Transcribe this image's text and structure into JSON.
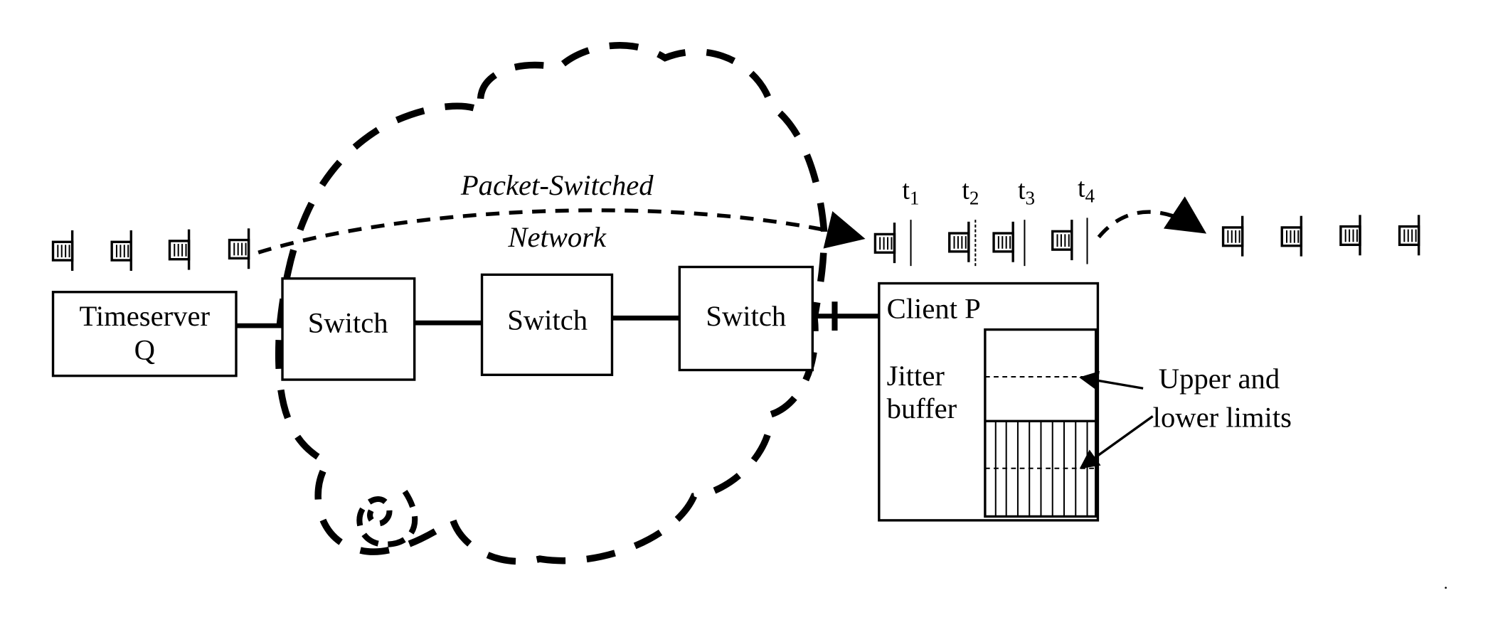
{
  "diagram": {
    "network_label_line1": "Packet-Switched",
    "network_label_line2": "Network",
    "timeserver_label_line1": "Timeserver",
    "timeserver_label_line2": "Q",
    "switches": [
      {
        "label": "Switch"
      },
      {
        "label": "Switch"
      },
      {
        "label": "Switch"
      }
    ],
    "client_label": "Client P",
    "jitter_label_line1": "Jitter",
    "jitter_label_line2": "buffer",
    "limits_label_line1": "Upper and",
    "limits_label_line2": "lower limits",
    "arrival_times": [
      {
        "base": "t",
        "sub": "1"
      },
      {
        "base": "t",
        "sub": "2"
      },
      {
        "base": "t",
        "sub": "3"
      },
      {
        "base": "t",
        "sub": "4"
      }
    ],
    "outgoing_packets_count": 4,
    "arriving_packets_count": 4,
    "output_packets_count": 4,
    "icons": {
      "packet": "packet-icon",
      "cloud": "network-cloud-icon",
      "arrow": "arrow-icon"
    },
    "colors": {
      "ink": "#000000",
      "background": "#ffffff"
    }
  }
}
